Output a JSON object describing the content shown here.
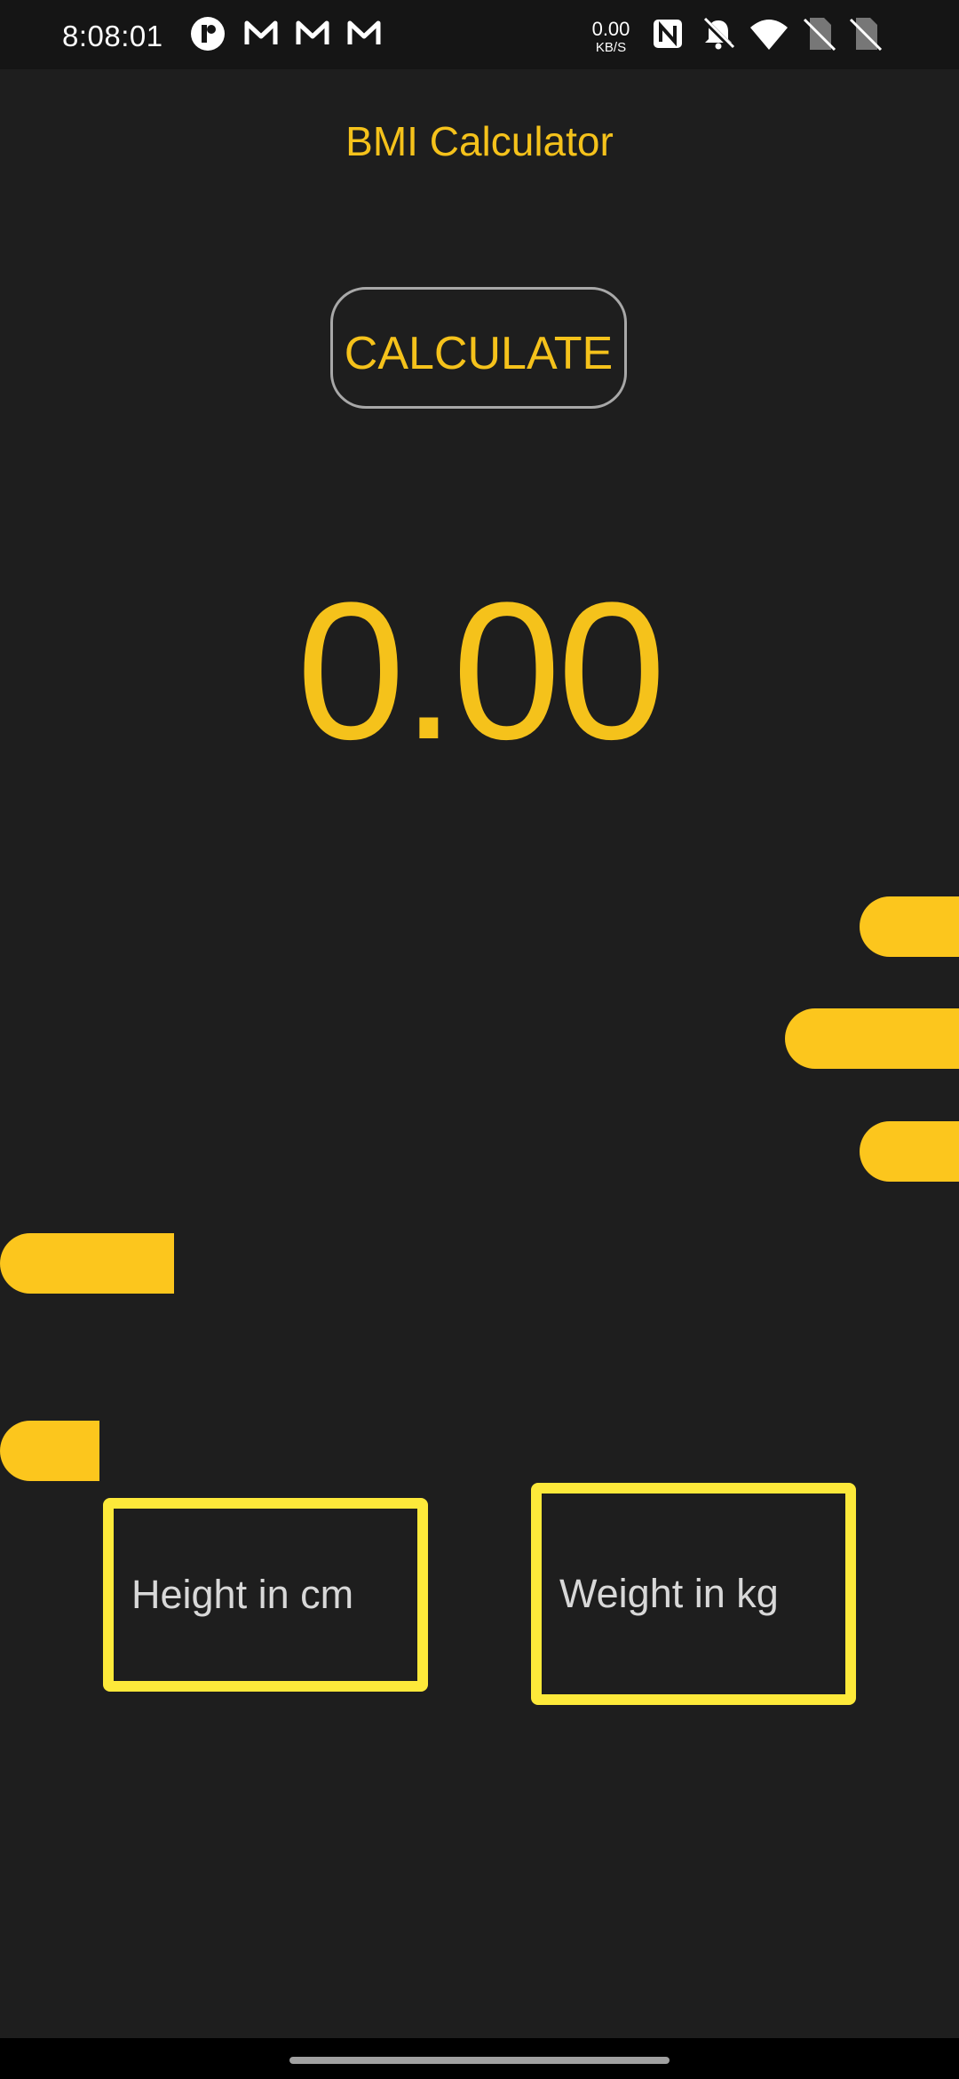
{
  "status_bar": {
    "time": "8:08:01",
    "net_speed_value": "0.00",
    "net_speed_unit": "KB/S",
    "icons": [
      "app-notification-icon",
      "gmail-icon",
      "gmail-icon",
      "gmail-icon",
      "nfc-icon",
      "notifications-muted-icon",
      "wifi-icon",
      "no-sim-icon",
      "no-sim-icon"
    ]
  },
  "app": {
    "title": "BMI Calculator",
    "calculate_label": "CALCULATE",
    "result": "0.00",
    "height_placeholder": "Height in cm",
    "weight_placeholder": "Weight in kg"
  },
  "colors": {
    "background": "#1e1e1e",
    "accent": "#f5c21b",
    "field_border": "#fde93a"
  }
}
